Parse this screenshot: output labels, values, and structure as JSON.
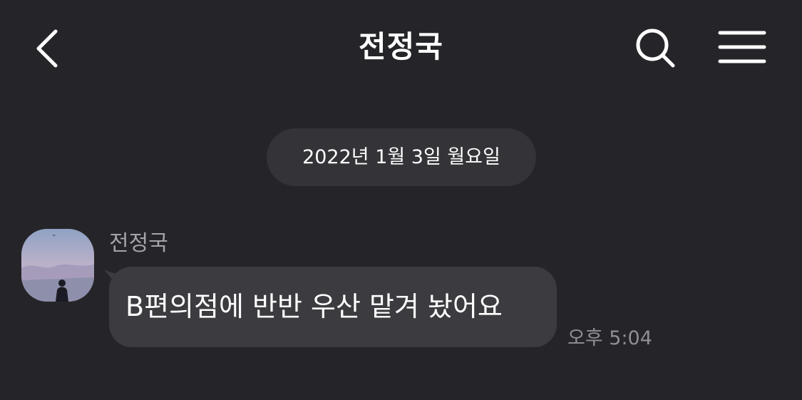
{
  "header": {
    "back_icon": "chevron-left-icon",
    "title": "전정국",
    "search_icon": "search-icon",
    "menu_icon": "hamburger-menu-icon"
  },
  "date_divider": {
    "text": "2022년 1월 3일 월요일"
  },
  "messages": [
    {
      "sender": "전정국",
      "avatar": "profile-avatar",
      "text": "B편의점에 반반 우산 맡겨 놨어요",
      "time": "오후 5:04"
    }
  ],
  "colors": {
    "background": "#252529",
    "bubble": "#3b3b40",
    "date_pill": "#333338",
    "sender_text": "#a3a3a8",
    "timestamp_text": "#8f8f94",
    "text": "#ffffff"
  }
}
